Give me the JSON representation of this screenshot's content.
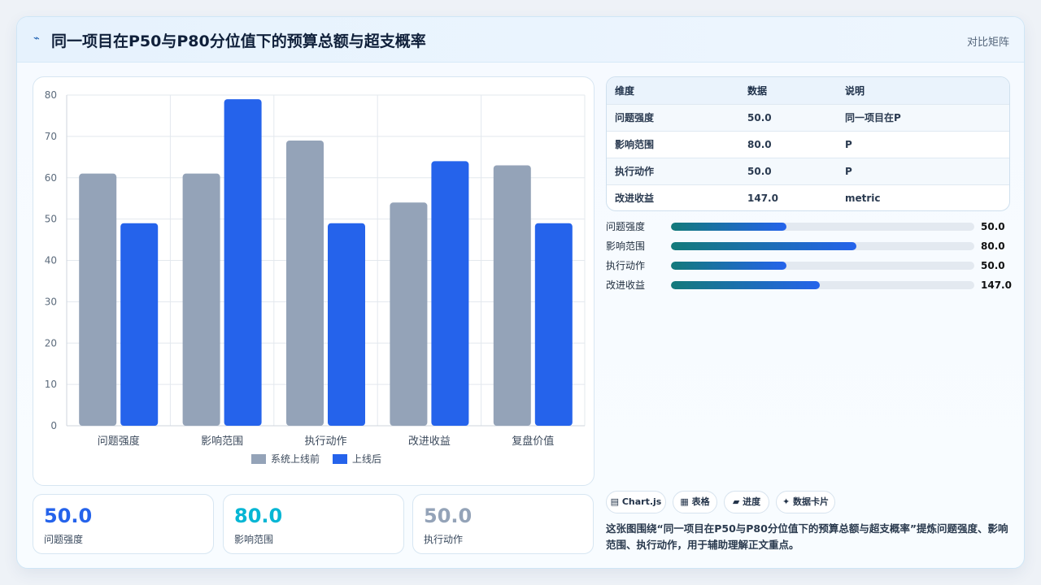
{
  "header": {
    "icon": "chart-spark-icon",
    "title": "同一项目在P50与P80分位值下的预算总额与超支概率",
    "mode": "对比矩阵"
  },
  "chart_data": {
    "type": "bar",
    "categories": [
      "问题强度",
      "影响范围",
      "执行动作",
      "改进收益",
      "复盘价值"
    ],
    "series": [
      {
        "name": "系统上线前",
        "values": [
          61,
          61,
          69,
          54,
          63
        ],
        "color": "#94a3b8"
      },
      {
        "name": "上线后",
        "values": [
          49,
          79,
          49,
          64,
          49
        ],
        "color": "#2563eb"
      }
    ],
    "ylim": [
      0,
      80
    ],
    "yticks": [
      "0",
      "10",
      "20",
      "30",
      "40",
      "50",
      "60",
      "70",
      "80"
    ],
    "grid": true,
    "legend": "bottom"
  },
  "table": {
    "headers": [
      "维度",
      "数据",
      "说明"
    ],
    "rows": [
      [
        "问题强度",
        "50.0",
        "同一项目在P"
      ],
      [
        "影响范围",
        "80.0",
        "P"
      ],
      [
        "执行动作",
        "50.0",
        "P"
      ],
      [
        "改进收益",
        "147.0",
        "metric"
      ]
    ]
  },
  "progress": [
    {
      "label": "问题强度",
      "value": "50.0",
      "fraction": 0.38
    },
    {
      "label": "影响范围",
      "value": "80.0",
      "fraction": 0.61
    },
    {
      "label": "执行动作",
      "value": "50.0",
      "fraction": 0.38
    },
    {
      "label": "改进收益",
      "value": "147.0",
      "fraction": 0.49
    }
  ],
  "stats": [
    {
      "value": "50.0",
      "label": "问题强度",
      "color": "#2563eb"
    },
    {
      "value": "80.0",
      "label": "影响范围",
      "color": "#06b6d4"
    },
    {
      "value": "50.0",
      "label": "执行动作",
      "color": "#94a3b8"
    }
  ],
  "chips": [
    {
      "label": "▤ Chart.js",
      "icon": "chart-icon"
    },
    {
      "label": "▦ 表格",
      "icon": "table-icon"
    },
    {
      "label": "▰ 进度",
      "icon": "progress-icon"
    },
    {
      "label": "✦ 数据卡片",
      "icon": "sparkle-icon"
    }
  ],
  "description": "这张图围绕“同一项目在P50与P80分位值下的预算总额与超支概率”提炼问题强度、影响范围、执行动作，用于辅助理解正文重点。"
}
